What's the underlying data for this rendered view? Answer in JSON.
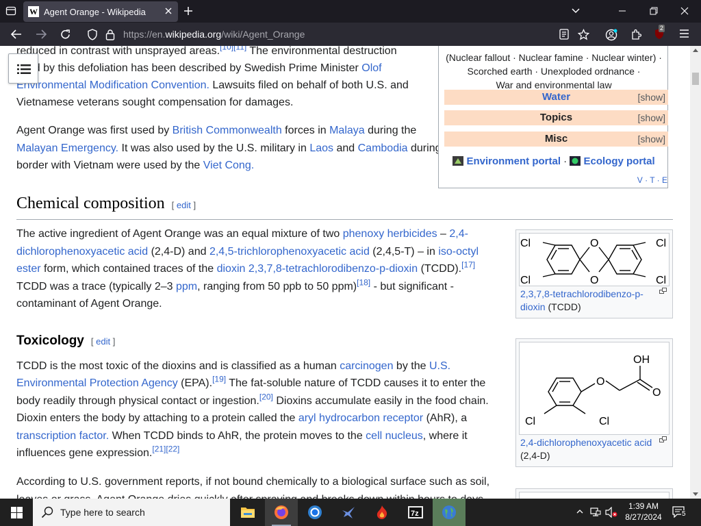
{
  "browser": {
    "tab_title": "Agent Orange - Wikipedia",
    "favicon_letter": "W",
    "url_prefix": "https://en.",
    "url_domain": "wikipedia.org",
    "url_path": "/wiki/Agent_Orange",
    "extension_badge": "2"
  },
  "intro": {
    "line1_a": "reduced in contrast with unsprayed areas.",
    "line1_ref1": "[10]",
    "line1_ref2": "[11]",
    "line1_b": " The environmental destruction",
    "line2_a": "used by this defoliation has been described by Swedish Prime Minister ",
    "line2_link": "Olof",
    "line3_link": "Environmental Modification Convention.",
    "line3_b": " Lawsuits filed on behalf of both U.S. and",
    "line4": "Vietnamese veterans sought compensation for damages.",
    "p2_l1_a": "Agent Orange was first used by ",
    "p2_l1_link1": "British Commonwealth",
    "p2_l1_b": " forces in ",
    "p2_l1_link2": "Malaya",
    "p2_l1_c": " during the",
    "p2_l2_link1": "Malayan Emergency.",
    "p2_l2_b": " It was also used by the U.S. military in ",
    "p2_l2_link2": "Laos",
    "p2_l2_c": " and ",
    "p2_l2_link3": "Cambodia",
    "p2_l2_d": " during",
    "p2_l3_a": "border with Vietnam were used by the ",
    "p2_l3_link": "Viet Cong."
  },
  "navbox": {
    "line1": "(Nuclear fallout · Nuclear famine · Nuclear winter) ·",
    "line2": "Scorched earth · Unexploded ordnance ·",
    "line3": "War and environmental law",
    "rows": [
      {
        "label": "Water",
        "show": "[show]"
      },
      {
        "label": "Topics",
        "show": "[show]"
      },
      {
        "label": "Misc",
        "show": "[show]"
      }
    ],
    "portal1": "Environment portal",
    "portal_sep": "·",
    "portal2": "Ecology portal",
    "vte": "V · T · E"
  },
  "chem": {
    "heading": "Chemical composition",
    "edit": "edit",
    "l1_a": "The active ingredient of Agent Orange was an equal mixture of two ",
    "l1_link1": "phenoxy herbicides",
    "l1_b": " – ",
    "l1_link2": "2,4-",
    "l2_link1": "dichlorophenoxyacetic acid",
    "l2_b": " (2,4-D) and ",
    "l2_link2": "2,4,5-trichlorophenoxyacetic acid",
    "l2_c": " (2,4,5-T) – in ",
    "l2_link3": "iso-octyl",
    "l3_link1": "ester",
    "l3_b": " form, which contained traces of the ",
    "l3_link2": "dioxin",
    "l3_link3": "2,3,7,8-tetrachlorodibenzo-p-dioxin",
    "l3_c": " (TCDD).",
    "l3_ref": "[17]",
    "l4_a": "TCDD was a trace (typically 2–3 ",
    "l4_link": "ppm",
    "l4_b": ", ranging from 50 ppb to 50 ppm)",
    "l4_ref": "[18]",
    "l4_c": " - but significant -",
    "l5": "contaminant of Agent Orange.",
    "fig_caption_link": "2,3,7,8-tetrachlorodibenzo-p-dioxin",
    "fig_caption_b": " (TCDD)",
    "atom_cl": "Cl",
    "atom_o": "O"
  },
  "tox": {
    "heading": "Toxicology",
    "edit": "edit",
    "l1_a": "TCDD is the most toxic of the dioxins and is classified as a human ",
    "l1_link1": "carcinogen",
    "l1_b": " by the ",
    "l1_link2": "U.S.",
    "l2_link": "Environmental Protection Agency",
    "l2_b": " (EPA).",
    "l2_ref": "[19]",
    "l2_c": " The fat-soluble nature of TCDD causes it to enter the",
    "l3_a": "body readily through physical contact or ingestion.",
    "l3_ref": "[20]",
    "l3_b": " Dioxins accumulate easily in the food chain.",
    "l4_a": "Dioxin enters the body by attaching to a protein called the ",
    "l4_link": "aryl hydrocarbon receptor",
    "l4_b": " (AhR), a",
    "l5_link": "transcription factor.",
    "l5_b": " When TCDD binds to AhR, the protein moves to the ",
    "l5_link2": "cell nucleus",
    "l5_c": ", where it",
    "l6_a": "influences gene expression.",
    "l6_ref": "[21][22]",
    "l7": "According to U.S. government reports, if not bound chemically to a biological surface such as soil,",
    "l8": "leaves or grass, Agent Orange dries quickly after spraying and breaks down within hours to days",
    "fig_caption_link": "2,4-dichlorophenoxyacetic acid",
    "fig_caption_b": "(2,4-D)",
    "atom_oh": "OH",
    "atom_o": "O",
    "atom_cl": "Cl"
  },
  "taskbar": {
    "search_placeholder": "Type here to search",
    "time": "1:39 AM",
    "date": "8/27/2024",
    "notification_count": "5"
  }
}
